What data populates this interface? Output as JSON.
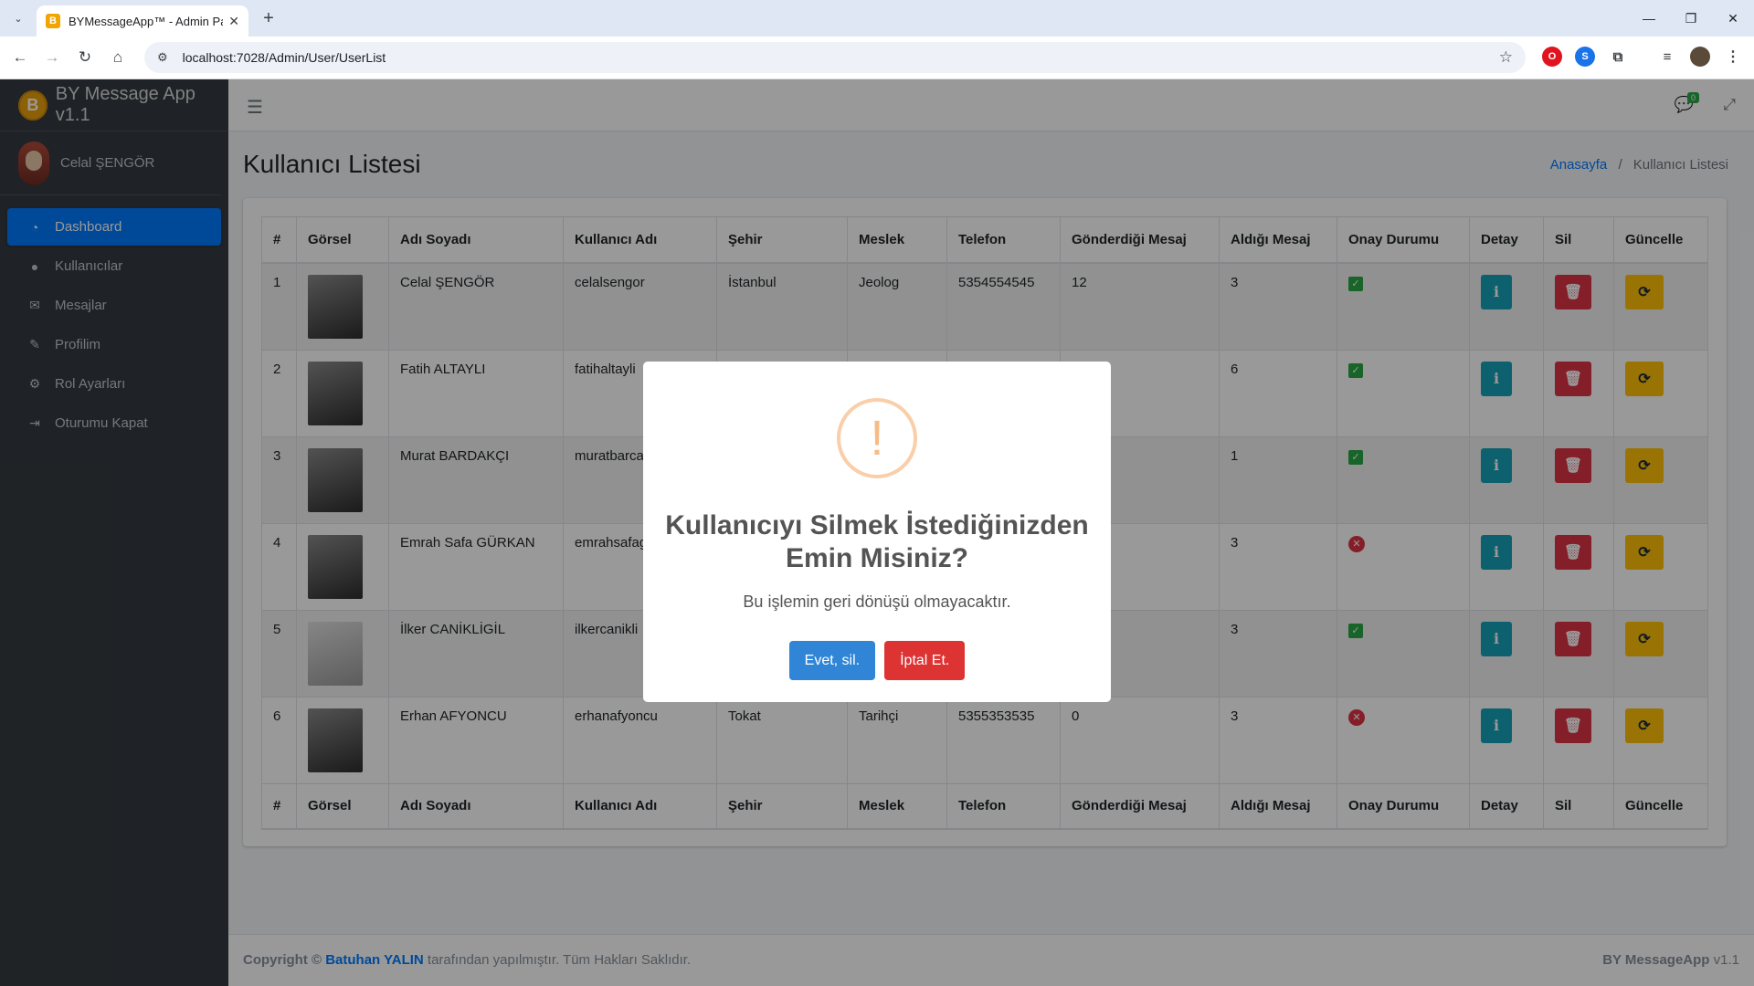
{
  "browser": {
    "tab_title": "BYMessageApp™ - Admin Pane",
    "url": "localhost:7028/Admin/User/UserList"
  },
  "brand": {
    "name": "BY Message App v1.1"
  },
  "user": {
    "name": "Celal ŞENGÖR"
  },
  "sidebar": {
    "items": [
      {
        "label": "Dashboard",
        "icon": "dashboard-icon"
      },
      {
        "label": "Kullanıcılar",
        "icon": "user-icon"
      },
      {
        "label": "Mesajlar",
        "icon": "envelope-icon"
      },
      {
        "label": "Profilim",
        "icon": "user-edit-icon"
      },
      {
        "label": "Rol Ayarları",
        "icon": "cogs-icon"
      },
      {
        "label": "Oturumu Kapat",
        "icon": "sign-out-icon"
      }
    ]
  },
  "topnav": {
    "message_count": "0"
  },
  "page": {
    "title": "Kullanıcı Listesi",
    "breadcrumb_home": "Anasayfa",
    "breadcrumb_current": "Kullanıcı Listesi"
  },
  "table": {
    "headers": [
      "#",
      "Görsel",
      "Adı Soyadı",
      "Kullanıcı Adı",
      "Şehir",
      "Meslek",
      "Telefon",
      "Gönderdiği Mesaj",
      "Aldığı Mesaj",
      "Onay Durumu",
      "Detay",
      "Sil",
      "Güncelle"
    ],
    "rows": [
      {
        "no": "1",
        "name": "Celal ŞENGÖR",
        "username": "celalsengor",
        "city": "İstanbul",
        "job": "Jeolog",
        "phone": "5354554545",
        "sent": "12",
        "received": "3",
        "approved": true
      },
      {
        "no": "2",
        "name": "Fatih ALTAYLI",
        "username": "fatihaltayli",
        "city": "",
        "job": "",
        "phone": "",
        "sent": "",
        "received": "6",
        "approved": true
      },
      {
        "no": "3",
        "name": "Murat BARDAKÇI",
        "username": "muratbarca",
        "city": "",
        "job": "",
        "phone": "",
        "sent": "",
        "received": "1",
        "approved": true
      },
      {
        "no": "4",
        "name": "Emrah Safa GÜRKAN",
        "username": "emrahsafag",
        "city": "",
        "job": "",
        "phone": "",
        "sent": "",
        "received": "3",
        "approved": false
      },
      {
        "no": "5",
        "name": "İlker CANİKLİGİL",
        "username": "ilkercanikli",
        "city": "",
        "job": "",
        "phone": "",
        "sent": "",
        "received": "3",
        "approved": true
      },
      {
        "no": "6",
        "name": "Erhan AFYONCU",
        "username": "erhanafyoncu",
        "city": "Tokat",
        "job": "Tarihçi",
        "phone": "5355353535",
        "sent": "0",
        "received": "3",
        "approved": false
      }
    ]
  },
  "footer": {
    "copyright_prefix": "Copyright ©",
    "author": "Batuhan YALIN",
    "suffix": "tarafından yapılmıştır. Tüm Hakları Saklıdır.",
    "app_name": "BY MessageApp",
    "version": "v1.1"
  },
  "modal": {
    "icon": "!",
    "title": "Kullanıcıyı Silmek İstediğinizden Emin Misiniz?",
    "text": "Bu işlemin geri dönüşü olmayacaktır.",
    "confirm_label": "Evet, sil.",
    "cancel_label": "İptal Et."
  },
  "colors": {
    "primary": "#007bff",
    "sidebar": "#343a40",
    "confirm": "#3085d6",
    "cancel": "#dd3333",
    "warning_icon": "#f8bb86"
  }
}
